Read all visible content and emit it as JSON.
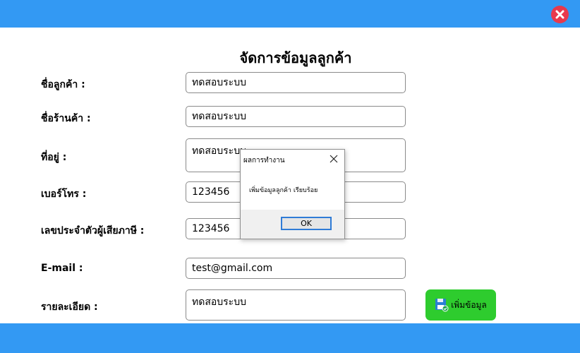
{
  "window": {
    "close_icon": "close-icon",
    "accent_color": "#3399f3",
    "close_color": "#e8394d"
  },
  "form": {
    "title": "จัดการข้อมูลลูกค้า",
    "fields": {
      "customer_name": {
        "label": "ชื่อลูกค้า :",
        "value": "ทดสอบระบบ"
      },
      "shop_name": {
        "label": "ชื่อร้านค้า :",
        "value": "ทดสอบระบบ"
      },
      "address": {
        "label": "ที่อยู่ :",
        "value": "ทดสอบระบบ"
      },
      "phone": {
        "label": "เบอร์โทร :",
        "value": "123456"
      },
      "tax_id": {
        "label": "เลขประจำตัวผู้เสียภาษี :",
        "value": "123456"
      },
      "email": {
        "label": "E-mail :",
        "value": "test@gmail.com"
      },
      "details": {
        "label": "รายละเอียด :",
        "value": "ทดสอบระบบ"
      }
    },
    "add_button": {
      "label": "เพิ่มข้อมูล",
      "icon": "save-icon",
      "color": "#2ecc2e"
    }
  },
  "dialog": {
    "title": "ผลการทำงาน",
    "message": "เพิ่มข้อมูลลูกค้า เรียบร้อย",
    "ok_label": "OK",
    "close_icon": "close-icon"
  }
}
